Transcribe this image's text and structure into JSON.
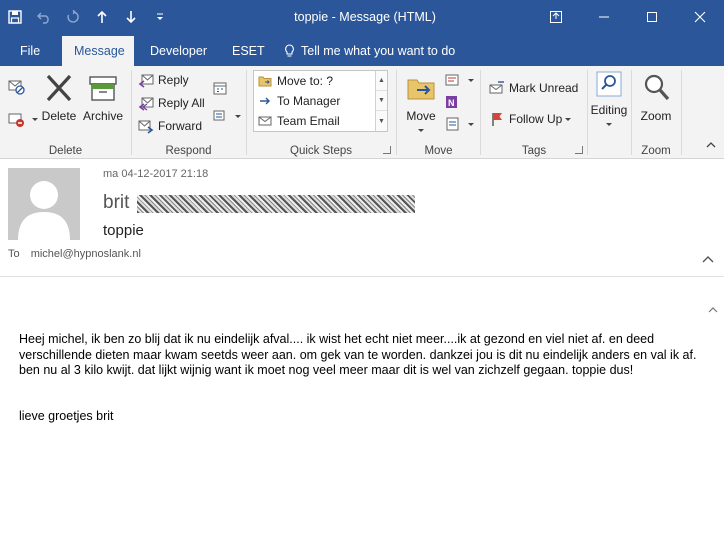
{
  "window": {
    "title": "toppie  -  Message (HTML)"
  },
  "tabs": [
    {
      "label": "File"
    },
    {
      "label": "Message"
    },
    {
      "label": "Developer"
    },
    {
      "label": "ESET"
    },
    {
      "label": "Tell me what you want to do"
    }
  ],
  "ribbon": {
    "delete_group": {
      "label": "Delete",
      "delete": "Delete",
      "archive": "Archive"
    },
    "respond_group": {
      "label": "Respond",
      "reply": "Reply",
      "reply_all": "Reply All",
      "forward": "Forward"
    },
    "quick_steps_group": {
      "label": "Quick Steps",
      "items": [
        "Move to: ?",
        "To Manager",
        "Team Email"
      ]
    },
    "move_group": {
      "label": "Move",
      "move": "Move"
    },
    "tags_group": {
      "label": "Tags",
      "mark_unread": "Mark Unread",
      "follow_up": "Follow Up"
    },
    "editing_group": {
      "editing": "Editing"
    },
    "zoom_group": {
      "label": "Zoom",
      "zoom": "Zoom"
    }
  },
  "message": {
    "date": "ma 04-12-2017 21:18",
    "sender": "brit",
    "subject": "toppie",
    "to_label": "To",
    "to_address": "michel@hypnoslank.nl",
    "body": "Heej michel, ik ben zo blij dat ik nu eindelijk afval.... ik wist het echt niet meer....ik at gezond en viel niet af. en deed verschillende dieten maar kwam seetds weer aan. om gek van te worden. dankzei jou is dit nu eindelijk anders en val ik af. ben nu al 3 kilo kwijt. dat lijkt wijnig want ik moet nog veel meer maar dit is wel van zichzelf gegaan. toppie dus!",
    "signoff": "lieve groetjes brit"
  },
  "colors": {
    "accent": "#2b579a",
    "ribbon_bg": "#f3f3f3",
    "delete_red": "#c13a2f"
  }
}
